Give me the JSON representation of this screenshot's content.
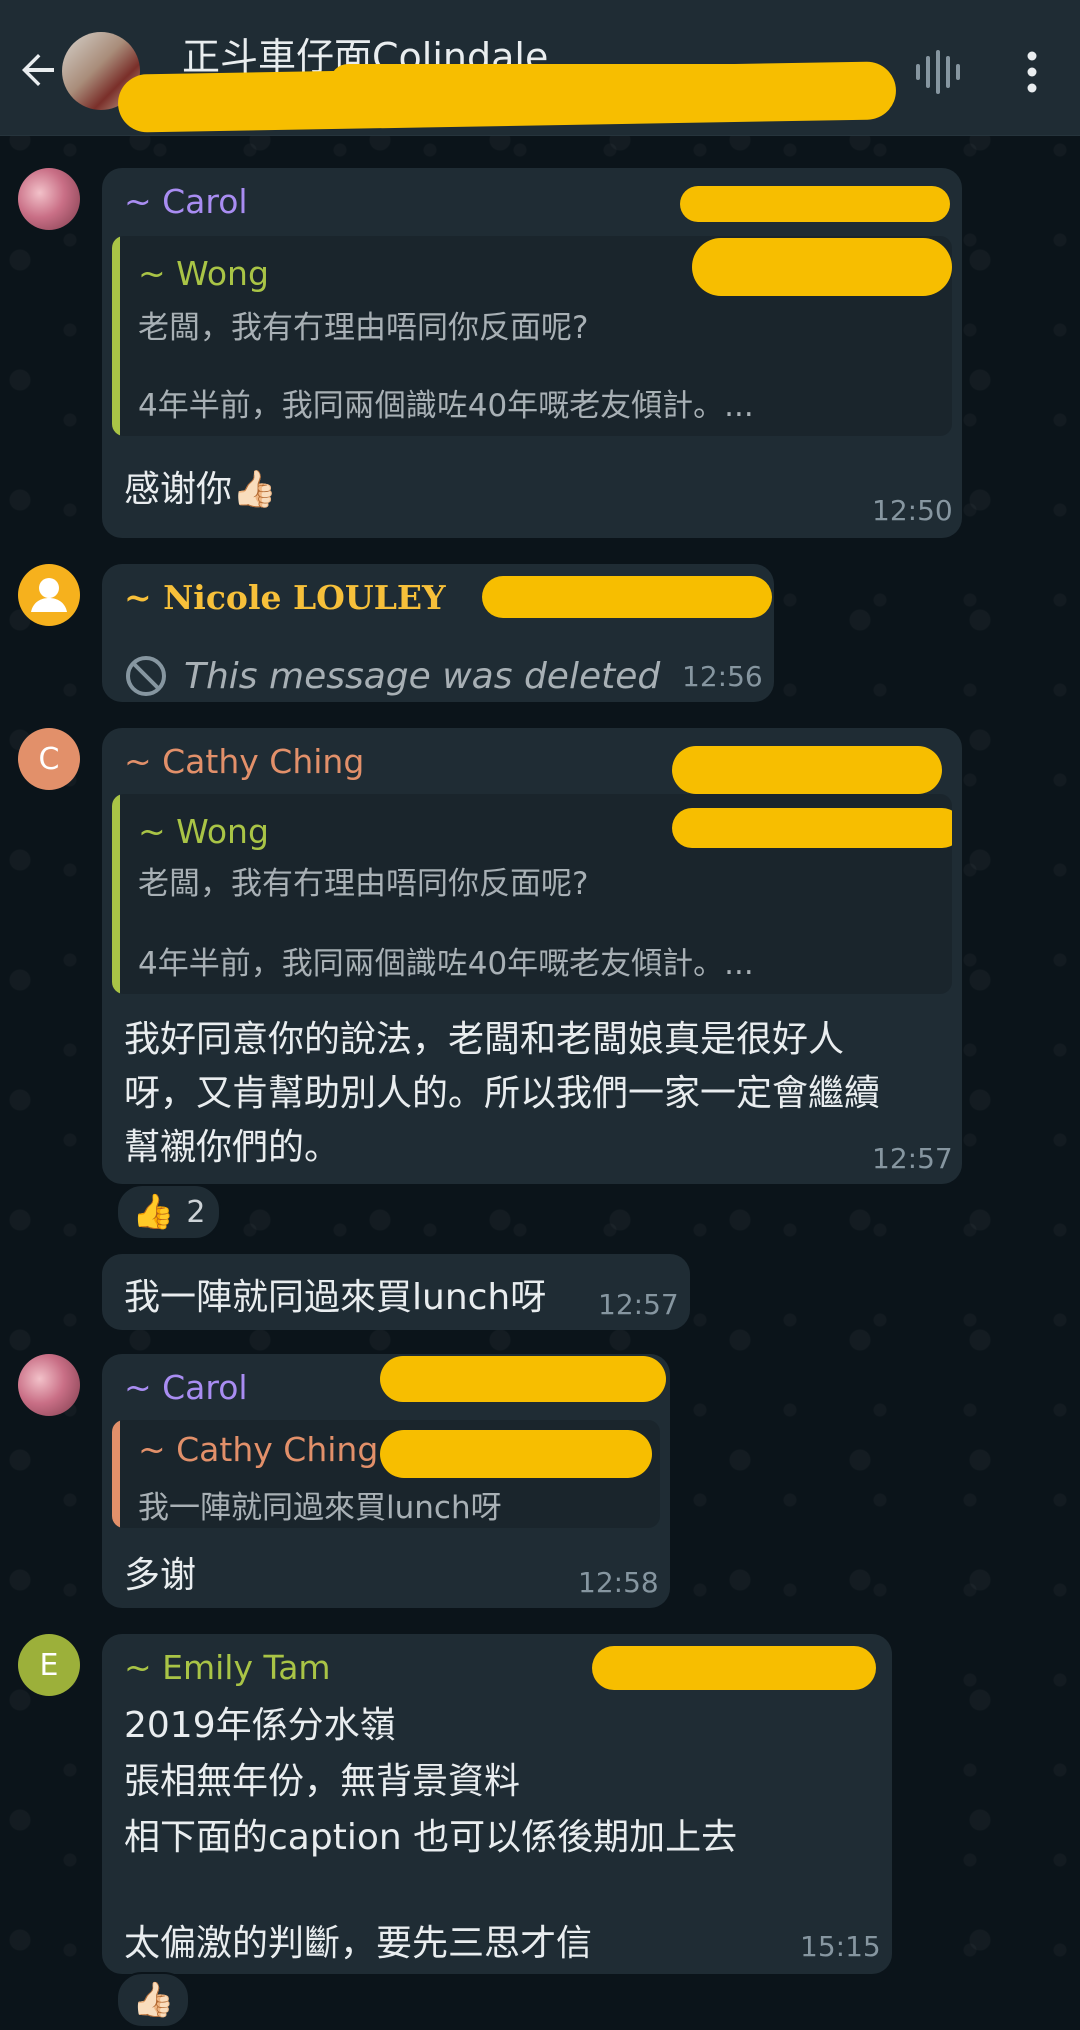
{
  "header": {
    "title": "正斗車仔面Colindale",
    "back_icon": "back-arrow-icon",
    "voice_icon": "voice-chat-icon",
    "menu_icon": "more-vert-icon",
    "redact_color": "#f7be00"
  },
  "messages": [
    {
      "sender": "~ Carol",
      "sender_color": "#a98df2",
      "quote": {
        "name": "~ Wong",
        "name_color": "#a9c446",
        "bar_color": "#a9c446",
        "line1": "老闆，我有冇理由唔同你反面呢?",
        "line2": "4年半前，我同兩個識咗40年嘅老友傾計。..."
      },
      "text": "感谢你👍🏻",
      "time": "12:50"
    },
    {
      "sender": "~ Nicole LOULEY",
      "deleted_text": "This message was deleted",
      "time": "12:56"
    },
    {
      "avatar_letter": "C",
      "sender": "~ Cathy Ching",
      "sender_color": "#e2906a",
      "quote": {
        "name": "~ Wong",
        "line1": "老闆，我有冇理由唔同你反面呢?",
        "line2": "4年半前，我同兩個識咗40年嘅老友傾計。..."
      },
      "text_lines": [
        "我好同意你的說法，老闆和老闆娘真是很好人",
        "呀，又肯幫助別人的。所以我們一家一定會繼續",
        "幫襯你們的。"
      ],
      "time": "12:57",
      "reaction": {
        "emoji": "👍",
        "count": "2"
      }
    },
    {
      "text": "我一陣就同過來買lunch呀",
      "time": "12:57"
    },
    {
      "sender": "~ Carol",
      "quote": {
        "name": "~ Cathy Ching",
        "line1": "我一陣就同過來買lunch呀"
      },
      "text": "多谢",
      "time": "12:58"
    },
    {
      "avatar_letter": "E",
      "sender": "~ Emily Tam",
      "sender_color": "#a9c446",
      "text_lines": [
        "2019年係分水嶺",
        "張相無年份，無背景資料",
        "相下面的caption 也可以係後期加上去",
        "",
        "太偏激的判斷，要先三思才信"
      ],
      "time": "15:15",
      "reaction": {
        "emoji": "👍🏻"
      }
    }
  ]
}
